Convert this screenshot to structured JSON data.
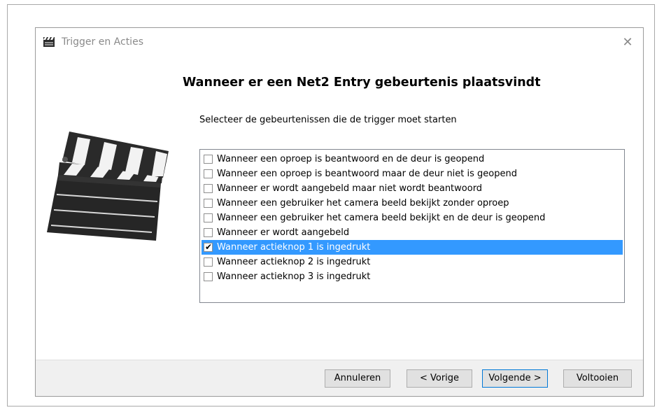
{
  "window": {
    "title": "Trigger en Acties",
    "close_label": "✕"
  },
  "main": {
    "heading": "Wanneer er een Net2 Entry gebeurtenis plaatsvindt",
    "instruction": "Selecteer de gebeurtenissen die de trigger moet starten"
  },
  "events": [
    {
      "label": "Wanneer een oproep is beantwoord en de deur is geopend",
      "checked": false,
      "selected": false
    },
    {
      "label": "Wanneer een oproep is beantwoord maar de deur niet is geopend",
      "checked": false,
      "selected": false
    },
    {
      "label": "Wanneer er wordt aangebeld maar niet wordt beantwoord",
      "checked": false,
      "selected": false
    },
    {
      "label": "Wanneer een gebruiker het camera beeld bekijkt zonder oproep",
      "checked": false,
      "selected": false
    },
    {
      "label": "Wanneer een gebruiker het camera beeld bekijkt en de deur is geopend",
      "checked": false,
      "selected": false
    },
    {
      "label": "Wanneer er wordt aangebeld",
      "checked": false,
      "selected": false
    },
    {
      "label": "Wanneer actieknop 1 is ingedrukt",
      "checked": true,
      "selected": true
    },
    {
      "label": "Wanneer actieknop 2 is ingedrukt",
      "checked": false,
      "selected": false
    },
    {
      "label": "Wanneer actieknop 3 is ingedrukt",
      "checked": false,
      "selected": false
    }
  ],
  "footer": {
    "cancel_label": "Annuleren",
    "back_label": "< Vorige",
    "next_label": "Volgende >",
    "finish_label": "Voltooien"
  },
  "icons": {
    "title_icon": "clapperboard-icon",
    "illustration": "clapperboard-icon",
    "close": "close-icon",
    "check": "check-icon"
  },
  "colors": {
    "selection": "#3399ff",
    "default_button_border": "#0078d7",
    "footer_bg": "#f0f0f0"
  }
}
